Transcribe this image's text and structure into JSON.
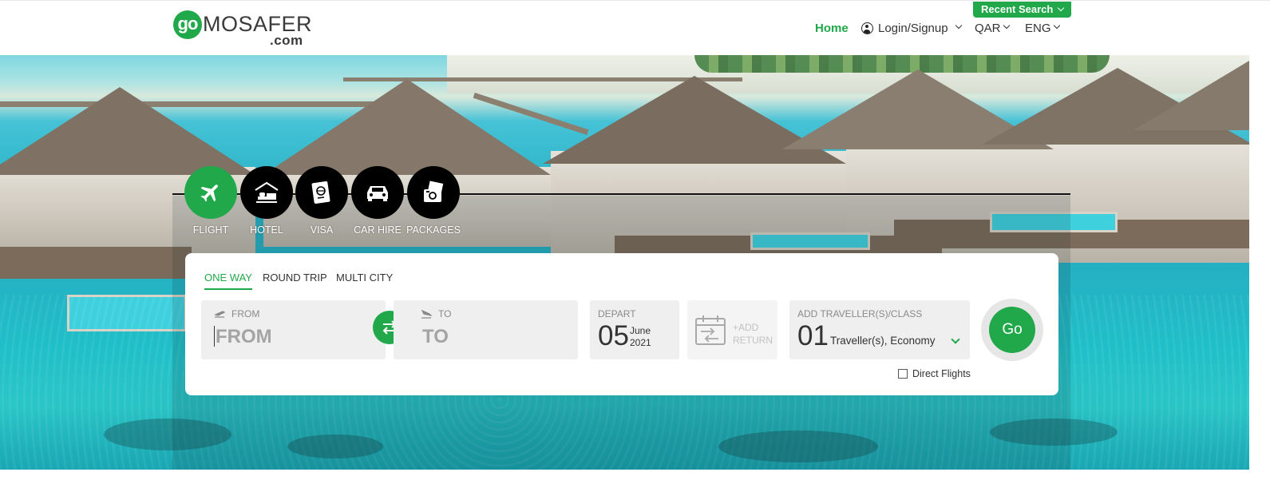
{
  "brand": {
    "logo_go": "go",
    "logo_word": "MOSAFER",
    "logo_com": ".com",
    "accent": "#21a84a"
  },
  "header": {
    "recent_search": "Recent Search",
    "nav": {
      "home": "Home",
      "login": "Login/Signup",
      "currency": "QAR",
      "language": "ENG"
    }
  },
  "products": [
    {
      "label": "FLIGHT",
      "icon": "plane-icon",
      "active": true
    },
    {
      "label": "HOTEL",
      "icon": "hotel-icon",
      "active": false
    },
    {
      "label": "VISA",
      "icon": "passport-icon",
      "active": false
    },
    {
      "label": "CAR HIRE",
      "icon": "car-icon",
      "active": false
    },
    {
      "label": "PACKAGES",
      "icon": "packages-icon",
      "active": false
    }
  ],
  "search": {
    "trip_tabs": [
      {
        "label": "ONE WAY",
        "active": true
      },
      {
        "label": "ROUND TRIP",
        "active": false
      },
      {
        "label": "MULTI CITY",
        "active": false
      }
    ],
    "from": {
      "label": "FROM",
      "placeholder": "FROM"
    },
    "to": {
      "label": "TO",
      "placeholder": "TO"
    },
    "depart": {
      "label": "DEPART",
      "day": "05",
      "month": "June",
      "year": "2021"
    },
    "return": {
      "line1": "+ADD",
      "line2": "RETURN"
    },
    "travellers": {
      "label": "ADD TRAVELLER(S)/CLASS",
      "count": "01",
      "summary": "Traveller(s), Economy"
    },
    "go_label": "Go",
    "direct_flights": {
      "label": "Direct Flights",
      "checked": false
    }
  }
}
